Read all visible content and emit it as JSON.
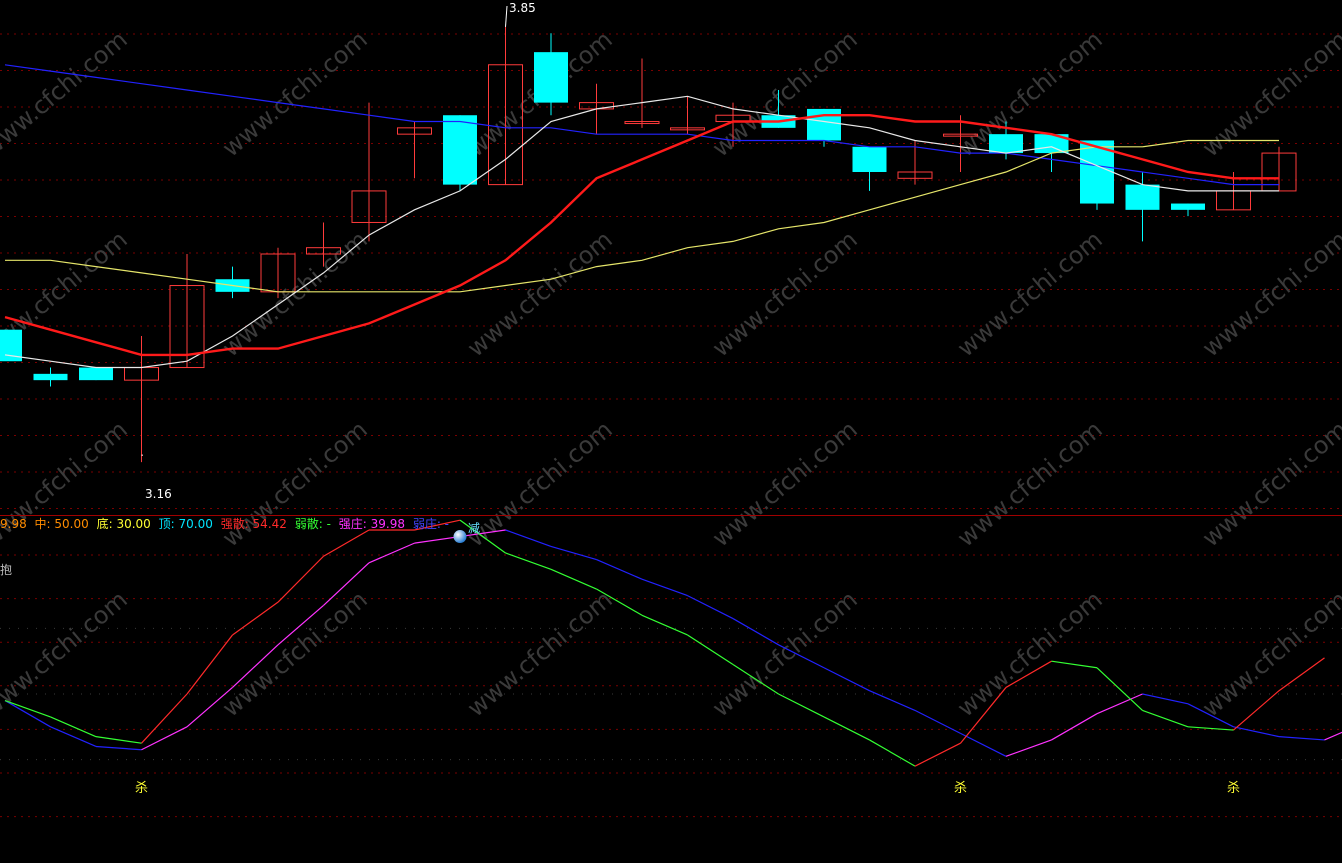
{
  "colors": {
    "background": "#000000",
    "grid": "#7a0000",
    "up_candle": "#ff3b3b",
    "down_candle": "#00ffff",
    "ma_white": "#e8e8e8",
    "ma_red": "#ff1a1a",
    "ma_yellow": "#e5e56a",
    "ma_blue": "#2222ff",
    "panel_divider": "#a00000",
    "signal_text": "#ffff33",
    "watermark": "#3a3a3a"
  },
  "price_panel": {
    "price_range": [
      3.1,
      3.88
    ],
    "high_label": "3.85",
    "low_label": "3.16",
    "candles": [
      {
        "o": 3.37,
        "h": 3.37,
        "l": 3.33,
        "c": 3.32
      },
      {
        "o": 3.3,
        "h": 3.31,
        "l": 3.28,
        "c": 3.29
      },
      {
        "o": 3.31,
        "h": 3.31,
        "l": 3.29,
        "c": 3.29
      },
      {
        "o": 3.29,
        "h": 3.36,
        "l": 3.16,
        "c": 3.31
      },
      {
        "o": 3.31,
        "h": 3.49,
        "l": 3.31,
        "c": 3.44
      },
      {
        "o": 3.45,
        "h": 3.47,
        "l": 3.42,
        "c": 3.43
      },
      {
        "o": 3.43,
        "h": 3.5,
        "l": 3.42,
        "c": 3.49
      },
      {
        "o": 3.49,
        "h": 3.54,
        "l": 3.47,
        "c": 3.5
      },
      {
        "o": 3.54,
        "h": 3.73,
        "l": 3.51,
        "c": 3.59
      },
      {
        "o": 3.68,
        "h": 3.7,
        "l": 3.61,
        "c": 3.69
      },
      {
        "o": 3.71,
        "h": 3.71,
        "l": 3.59,
        "c": 3.6
      },
      {
        "o": 3.6,
        "h": 3.85,
        "l": 3.6,
        "c": 3.79
      },
      {
        "o": 3.81,
        "h": 3.84,
        "l": 3.71,
        "c": 3.73
      },
      {
        "o": 3.72,
        "h": 3.76,
        "l": 3.68,
        "c": 3.73
      },
      {
        "o": 3.7,
        "h": 3.8,
        "l": 3.69,
        "c": 3.7
      },
      {
        "o": 3.69,
        "h": 3.74,
        "l": 3.68,
        "c": 3.69
      },
      {
        "o": 3.7,
        "h": 3.73,
        "l": 3.66,
        "c": 3.71
      },
      {
        "o": 3.71,
        "h": 3.75,
        "l": 3.69,
        "c": 3.69
      },
      {
        "o": 3.72,
        "h": 3.72,
        "l": 3.66,
        "c": 3.67
      },
      {
        "o": 3.66,
        "h": 3.66,
        "l": 3.59,
        "c": 3.62
      },
      {
        "o": 3.61,
        "h": 3.67,
        "l": 3.6,
        "c": 3.62
      },
      {
        "o": 3.68,
        "h": 3.71,
        "l": 3.62,
        "c": 3.68
      },
      {
        "o": 3.68,
        "h": 3.7,
        "l": 3.64,
        "c": 3.65
      },
      {
        "o": 3.68,
        "h": 3.68,
        "l": 3.62,
        "c": 3.65
      },
      {
        "o": 3.67,
        "h": 3.67,
        "l": 3.56,
        "c": 3.57
      },
      {
        "o": 3.6,
        "h": 3.62,
        "l": 3.51,
        "c": 3.56
      },
      {
        "o": 3.57,
        "h": 3.57,
        "l": 3.55,
        "c": 3.56
      },
      {
        "o": 3.56,
        "h": 3.62,
        "l": 3.56,
        "c": 3.59
      },
      {
        "o": 3.59,
        "h": 3.66,
        "l": 3.59,
        "c": 3.65
      }
    ],
    "ma_white": [
      3.33,
      3.32,
      3.31,
      3.31,
      3.32,
      3.36,
      3.41,
      3.46,
      3.52,
      3.56,
      3.59,
      3.64,
      3.7,
      3.72,
      3.73,
      3.74,
      3.72,
      3.71,
      3.7,
      3.69,
      3.67,
      3.66,
      3.65,
      3.66,
      3.63,
      3.6,
      3.59,
      3.59,
      3.59
    ],
    "ma_red": [
      3.39,
      3.37,
      3.35,
      3.33,
      3.33,
      3.34,
      3.34,
      3.36,
      3.38,
      3.41,
      3.44,
      3.48,
      3.54,
      3.61,
      3.64,
      3.67,
      3.7,
      3.7,
      3.71,
      3.71,
      3.7,
      3.7,
      3.69,
      3.68,
      3.66,
      3.64,
      3.62,
      3.61,
      3.61
    ],
    "ma_yellow": [
      3.48,
      3.48,
      3.47,
      3.46,
      3.45,
      3.44,
      3.43,
      3.43,
      3.43,
      3.43,
      3.43,
      3.44,
      3.45,
      3.47,
      3.48,
      3.5,
      3.51,
      3.53,
      3.54,
      3.56,
      3.58,
      3.6,
      3.62,
      3.65,
      3.66,
      3.66,
      3.67,
      3.67,
      3.67
    ],
    "ma_blue": [
      3.79,
      3.78,
      3.77,
      3.76,
      3.75,
      3.74,
      3.73,
      3.72,
      3.71,
      3.7,
      3.7,
      3.69,
      3.69,
      3.68,
      3.68,
      3.68,
      3.67,
      3.67,
      3.67,
      3.66,
      3.66,
      3.65,
      3.65,
      3.64,
      3.63,
      3.62,
      3.61,
      3.6,
      3.6
    ]
  },
  "indicator_panel": {
    "legend": [
      {
        "text": "9.98",
        "color": "#ff8c00"
      },
      {
        "text": "中: 50.00",
        "color": "#ff8c00"
      },
      {
        "text": "底: 30.00",
        "color": "#ffff33"
      },
      {
        "text": "顶: 70.00",
        "color": "#00e5ff"
      },
      {
        "text": "强散: 54.42",
        "color": "#ff2a2a"
      },
      {
        "text": "弱散: -",
        "color": "#33ff33"
      },
      {
        "text": "强庄: 39.98",
        "color": "#ff33ff"
      },
      {
        "text": "弱庄: -",
        "color": "#4444ff"
      }
    ],
    "side_label": "抱",
    "value_range": [
      0,
      100
    ],
    "guides": [
      30,
      50,
      70
    ],
    "fast_line": [
      48,
      43,
      37,
      35,
      50,
      68,
      78,
      92,
      100,
      100,
      103,
      93,
      88,
      82,
      74,
      68,
      59,
      50,
      43,
      36,
      28,
      35,
      52,
      60,
      58,
      45,
      40,
      39,
      51,
      61
    ],
    "slow_line": [
      48,
      40,
      34,
      33,
      40,
      52,
      65,
      77,
      90,
      96,
      98,
      100,
      95,
      91,
      85,
      80,
      73,
      65,
      58,
      51,
      45,
      38,
      31,
      36,
      44,
      50,
      47,
      40,
      37,
      36,
      42
    ],
    "signals": [
      {
        "index": 3,
        "text": "杀"
      },
      {
        "index": 21,
        "text": "杀"
      },
      {
        "index": 27,
        "text": "杀"
      }
    ],
    "marker": {
      "index": 10,
      "text": "减"
    }
  },
  "watermark": "www.cfchi.com"
}
